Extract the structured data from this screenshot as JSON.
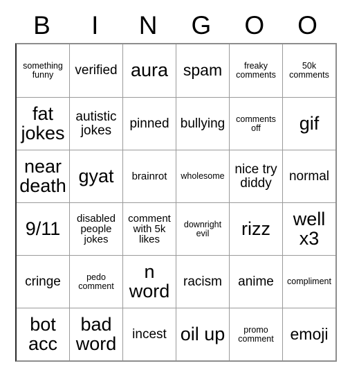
{
  "card": {
    "header_letters": [
      "B",
      "I",
      "N",
      "G",
      "O",
      "O"
    ],
    "columns": 6,
    "rows": 6,
    "colors": {
      "text": "#000000",
      "background": "#ffffff",
      "grid_line": "#9a9a9a",
      "outer_border": "#8d8d8d"
    },
    "cells": [
      [
        {
          "text": "something funny",
          "size": "xs"
        },
        {
          "text": "verified",
          "size": "md"
        },
        {
          "text": "aura",
          "size": "xl"
        },
        {
          "text": "spam",
          "size": "lg"
        },
        {
          "text": "freaky comments",
          "size": "xs"
        },
        {
          "text": "50k comments",
          "size": "xs"
        }
      ],
      [
        {
          "text": "fat jokes",
          "size": "xl"
        },
        {
          "text": "autistic jokes",
          "size": "md"
        },
        {
          "text": "pinned",
          "size": "md"
        },
        {
          "text": "bullying",
          "size": "md"
        },
        {
          "text": "comments off",
          "size": "xs"
        },
        {
          "text": "gif",
          "size": "xl"
        }
      ],
      [
        {
          "text": "near death",
          "size": "xl"
        },
        {
          "text": "gyat",
          "size": "xl"
        },
        {
          "text": "brainrot",
          "size": "sm"
        },
        {
          "text": "wholesome",
          "size": "xs"
        },
        {
          "text": "nice try diddy",
          "size": "md"
        },
        {
          "text": "normal",
          "size": "md"
        }
      ],
      [
        {
          "text": "9/11",
          "size": "xl"
        },
        {
          "text": "disabled people jokes",
          "size": "sm"
        },
        {
          "text": "comment with 5k likes",
          "size": "sm"
        },
        {
          "text": "downright evil",
          "size": "xs"
        },
        {
          "text": "rizz",
          "size": "xl"
        },
        {
          "text": "well x3",
          "size": "xl"
        }
      ],
      [
        {
          "text": "cringe",
          "size": "md"
        },
        {
          "text": "pedo comment",
          "size": "xs"
        },
        {
          "text": "n word",
          "size": "xl"
        },
        {
          "text": "racism",
          "size": "md"
        },
        {
          "text": "anime",
          "size": "md"
        },
        {
          "text": "compliment",
          "size": "xs"
        }
      ],
      [
        {
          "text": "bot acc",
          "size": "xl"
        },
        {
          "text": "bad word",
          "size": "xl"
        },
        {
          "text": "incest",
          "size": "md"
        },
        {
          "text": "oil up",
          "size": "xl"
        },
        {
          "text": "promo comment",
          "size": "xs"
        },
        {
          "text": "emoji",
          "size": "lg"
        }
      ]
    ]
  }
}
